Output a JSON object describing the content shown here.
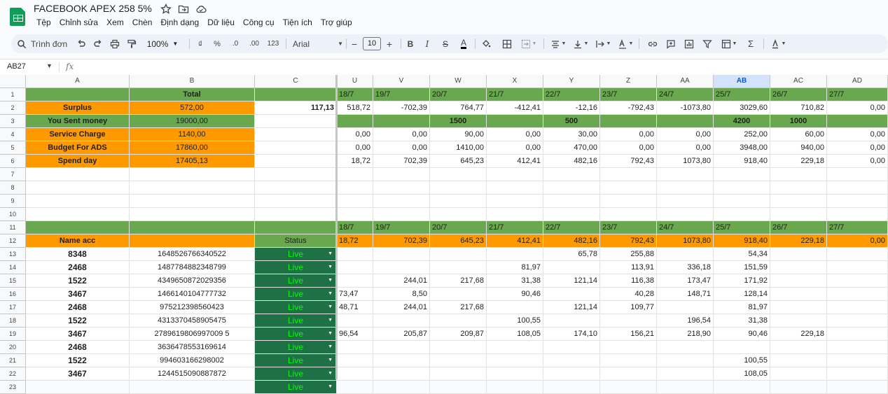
{
  "app": {
    "title": "FACEBOOK APEX 258 5%",
    "menu": [
      "Tệp",
      "Chỉnh sửa",
      "Xem",
      "Chèn",
      "Định dạng",
      "Dữ liệu",
      "Công cụ",
      "Tiện ích",
      "Trợ giúp"
    ],
    "colors": {
      "green": "#6aa84f",
      "orange": "#ff9900",
      "dark_green": "#1e7145",
      "live_text": "#00ff00",
      "selected_header": "#d3e3fd"
    }
  },
  "toolbar": {
    "search_label": "Trình đơn",
    "zoom": "100%",
    "currency": "₫",
    "percent": "%",
    "dec_decrease": ".0",
    "dec_increase": ".00",
    "number_format": "123",
    "font": "Arial",
    "font_size": "10"
  },
  "formula_bar": {
    "name_box": "AB27",
    "fx": "fx",
    "value": ""
  },
  "columns": [
    "A",
    "B",
    "C",
    "U",
    "V",
    "W",
    "X",
    "Y",
    "Z",
    "AA",
    "AB",
    "AC",
    "AD"
  ],
  "rows": [
    [
      "",
      "Total",
      "",
      "18/7",
      "19/7",
      "20/7",
      "21/7",
      "22/7",
      "23/7",
      "24/7",
      "25/7",
      "26/7",
      "27/7"
    ],
    [
      "Surplus",
      "572,00",
      "117,13",
      "518,72",
      "-702,39",
      "764,77",
      "-412,41",
      "-12,16",
      "-792,43",
      "-1073,80",
      "3029,60",
      "710,82",
      "0,00"
    ],
    [
      "You Sent money",
      "19000,00",
      "",
      "",
      "",
      "1500",
      "",
      "500",
      "",
      "",
      "4200",
      "1000",
      ""
    ],
    [
      "Service Charge",
      "1140,00",
      "",
      "0,00",
      "0,00",
      "90,00",
      "0,00",
      "30,00",
      "0,00",
      "0,00",
      "252,00",
      "60,00",
      "0,00"
    ],
    [
      "Budget For  ADS",
      "17860,00",
      "",
      "0,00",
      "0,00",
      "1410,00",
      "0,00",
      "470,00",
      "0,00",
      "0,00",
      "3948,00",
      "940,00",
      "0,00"
    ],
    [
      "Spend day",
      "17405,13",
      "",
      "18,72",
      "702,39",
      "645,23",
      "412,41",
      "482,16",
      "792,43",
      "1073,80",
      "918,40",
      "229,18",
      "0,00"
    ],
    [
      "",
      "",
      "",
      "",
      "",
      "",
      "",
      "",
      "",
      "",
      "",
      "",
      ""
    ],
    [
      "",
      "",
      "",
      "",
      "",
      "",
      "",
      "",
      "",
      "",
      "",
      "",
      ""
    ],
    [
      "",
      "",
      "",
      "",
      "",
      "",
      "",
      "",
      "",
      "",
      "",
      "",
      ""
    ],
    [
      "",
      "",
      "",
      "",
      "",
      "",
      "",
      "",
      "",
      "",
      "",
      "",
      ""
    ],
    [
      "",
      "",
      "",
      "18/7",
      "19/7",
      "20/7",
      "21/7",
      "22/7",
      "23/7",
      "24/7",
      "25/7",
      "26/7",
      "27/7"
    ],
    [
      "Name acc",
      "",
      "Status",
      "18,72",
      "702,39",
      "645,23",
      "412,41",
      "482,16",
      "792,43",
      "1073,80",
      "918,40",
      "229,18",
      "0,00"
    ],
    [
      "8348",
      "1648526766340522",
      "Live",
      "",
      "",
      "",
      "",
      "65,78",
      "255,88",
      "",
      "54,34",
      "",
      ""
    ],
    [
      "2468",
      "1487784882348799",
      "Live",
      "",
      "",
      "",
      "81,97",
      "",
      "113,91",
      "336,18",
      "151,59",
      "",
      ""
    ],
    [
      "1522",
      "4349650872029356",
      "Live",
      "",
      "244,01",
      "217,68",
      "31,38",
      "121,14",
      "116,38",
      "173,47",
      "171,92",
      "",
      ""
    ],
    [
      "3467",
      "1466140104777732",
      "Live",
      "73,47",
      "8,50",
      "",
      "90,46",
      "",
      "40,28",
      "148,71",
      "128,14",
      "",
      ""
    ],
    [
      "2468",
      "975212398560423",
      "Live",
      "48,71",
      "244,01",
      "217,68",
      "",
      "121,14",
      "109,77",
      "",
      "81,97",
      "",
      ""
    ],
    [
      "1522",
      "4313370458905475",
      "Live",
      "",
      "",
      "",
      "100,55",
      "",
      "",
      "196,54",
      "31,38",
      "",
      ""
    ],
    [
      "3467",
      "2789619806997009 5",
      "Live",
      "96,54",
      "205,87",
      "209,87",
      "108,05",
      "174,10",
      "156,21",
      "218,90",
      "90,46",
      "229,18",
      ""
    ],
    [
      "2468",
      "3636478553169614",
      "Live",
      "",
      "",
      "",
      "",
      "",
      "",
      "",
      "",
      "",
      ""
    ],
    [
      "1522",
      "994603166298002",
      "Live",
      "",
      "",
      "",
      "",
      "",
      "",
      "",
      "100,55",
      "",
      ""
    ],
    [
      "3467",
      "1244515090887872",
      "Live",
      "",
      "",
      "",
      "",
      "",
      "",
      "",
      "108,05",
      "",
      ""
    ],
    [
      "",
      "",
      "Live",
      "",
      "",
      "",
      "",
      "",
      "",
      "",
      "",
      "",
      ""
    ]
  ]
}
